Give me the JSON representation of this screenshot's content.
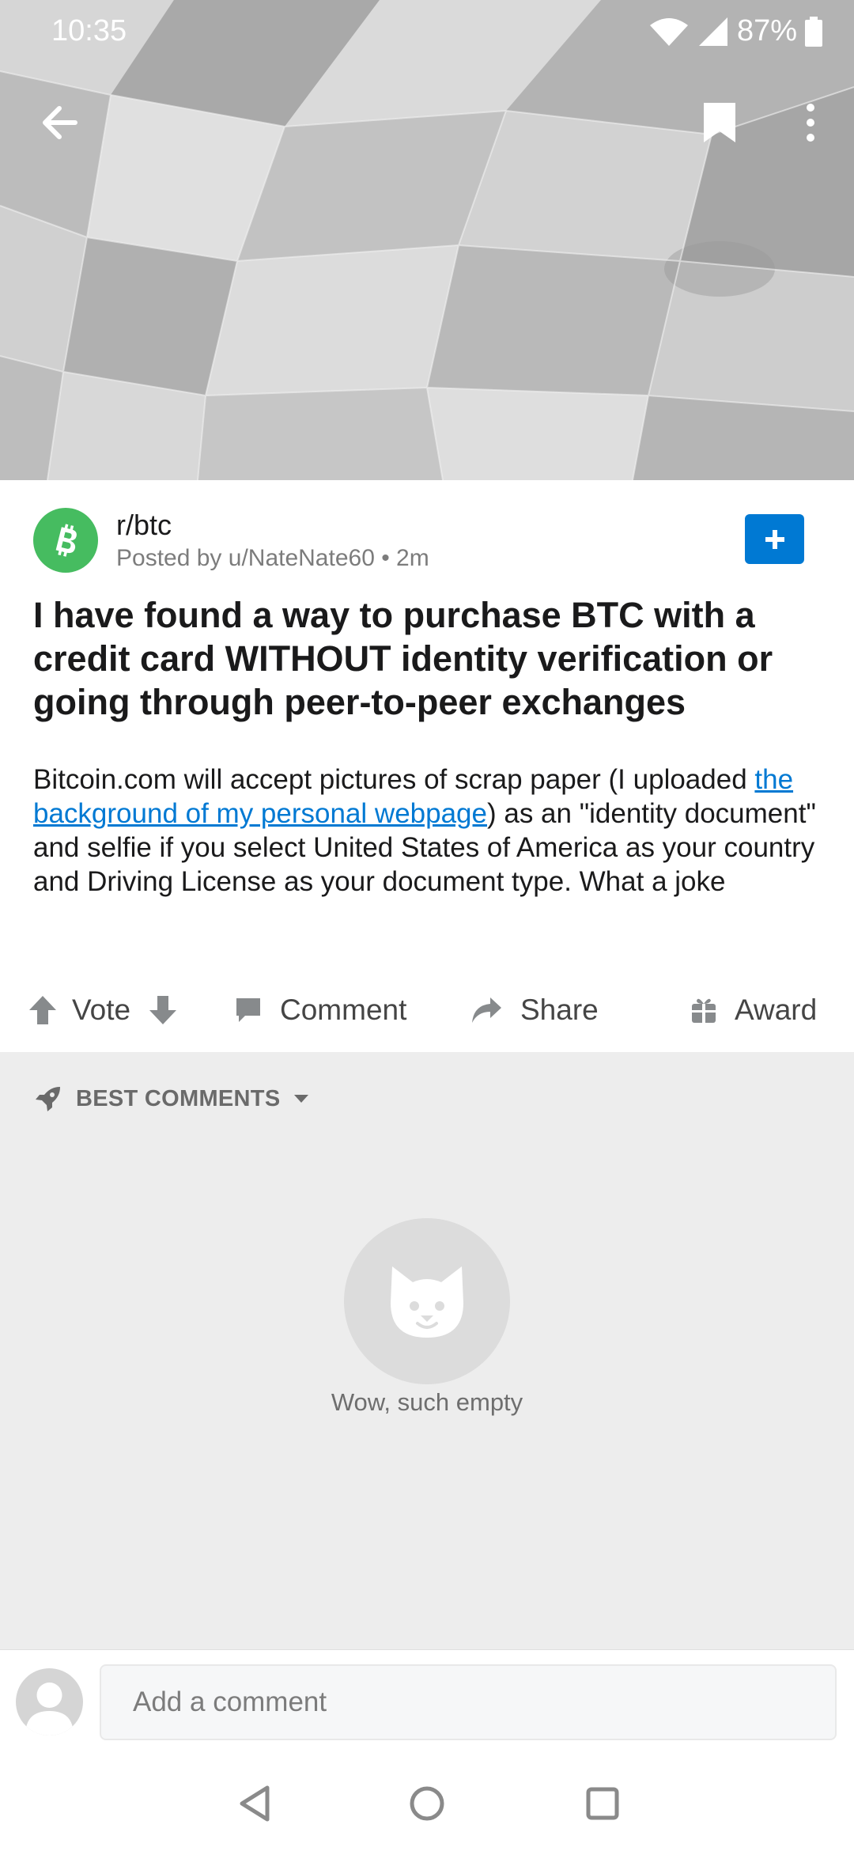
{
  "status_bar": {
    "time": "10:35",
    "battery": "87%"
  },
  "toolbar": {
    "back_icon": "arrow-left-icon",
    "bookmark_icon": "bookmark-icon",
    "more_icon": "more-vertical-icon"
  },
  "post": {
    "subreddit": "r/btc",
    "posted_by": "Posted by u/NateNate60 • 2m",
    "title": "I have found a way to purchase BTC with a credit card WITHOUT identity verification or going through peer-to-peer exchanges",
    "body_before_link": "Bitcoin.com will accept pictures of scrap paper (I uploaded ",
    "body_link": "the background of my personal webpage",
    "body_after_link": ") as an \"identity document\" and selfie if you select United States of America as your country and Driving License as your document type. What a joke",
    "join_icon": "plus-icon"
  },
  "actions": {
    "vote": "Vote",
    "comment": "Comment",
    "share": "Share",
    "award": "Award"
  },
  "comments": {
    "sort_label": "BEST COMMENTS",
    "empty_text": "Wow, such empty"
  },
  "comment_bar": {
    "placeholder": "Add a comment"
  },
  "colors": {
    "accent": "#0079d3",
    "subreddit_icon": "#46bc60",
    "comments_bg": "#ededed"
  }
}
